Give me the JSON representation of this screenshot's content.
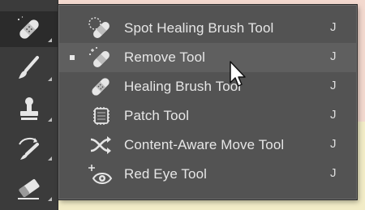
{
  "toolbar": {
    "tools": [
      {
        "name": "spot-healing-tool",
        "icon": "bandage-icon",
        "active": true
      },
      {
        "name": "brush-tool",
        "icon": "brush-icon",
        "active": false
      },
      {
        "name": "clone-stamp-tool",
        "icon": "stamp-icon",
        "active": false
      },
      {
        "name": "history-brush-tool",
        "icon": "history-brush-icon",
        "active": false
      },
      {
        "name": "eraser-tool",
        "icon": "eraser-icon",
        "active": false
      }
    ]
  },
  "menu": {
    "items": [
      {
        "label": "Spot Healing Brush Tool",
        "shortcut": "J",
        "icon": "spot-healing-brush-icon",
        "selected": false,
        "hover": false
      },
      {
        "label": "Remove Tool",
        "shortcut": "J",
        "icon": "remove-tool-icon",
        "selected": true,
        "hover": true
      },
      {
        "label": "Healing Brush Tool",
        "shortcut": "J",
        "icon": "healing-brush-icon",
        "selected": false,
        "hover": false
      },
      {
        "label": "Patch Tool",
        "shortcut": "J",
        "icon": "patch-icon",
        "selected": false,
        "hover": false
      },
      {
        "label": "Content-Aware Move Tool",
        "shortcut": "J",
        "icon": "content-aware-move-icon",
        "selected": false,
        "hover": false
      },
      {
        "label": "Red Eye Tool",
        "shortcut": "J",
        "icon": "red-eye-icon",
        "selected": false,
        "hover": false
      }
    ]
  },
  "colors": {
    "panel": "#535353",
    "toolbar": "#3b3b3b",
    "text": "#e6e6e6"
  }
}
